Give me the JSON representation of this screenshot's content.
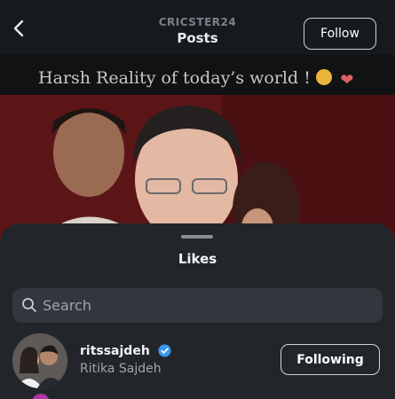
{
  "header": {
    "account_name": "CRICSTER24",
    "title": "Posts",
    "follow_label": "Follow",
    "back_icon": "chevron-left-icon"
  },
  "post": {
    "caption": "Harsh Reality of today’s world !"
  },
  "likes_sheet": {
    "title": "Likes",
    "search": {
      "placeholder": "Search",
      "value": ""
    },
    "users": [
      {
        "username": "ritssajdeh",
        "verified": true,
        "full_name": "Ritika Sajdeh",
        "button_label": "Following"
      }
    ]
  },
  "colors": {
    "sheet_background": "#22262b",
    "verified_badge": "#3897f0",
    "post_background": "#5a1416"
  }
}
